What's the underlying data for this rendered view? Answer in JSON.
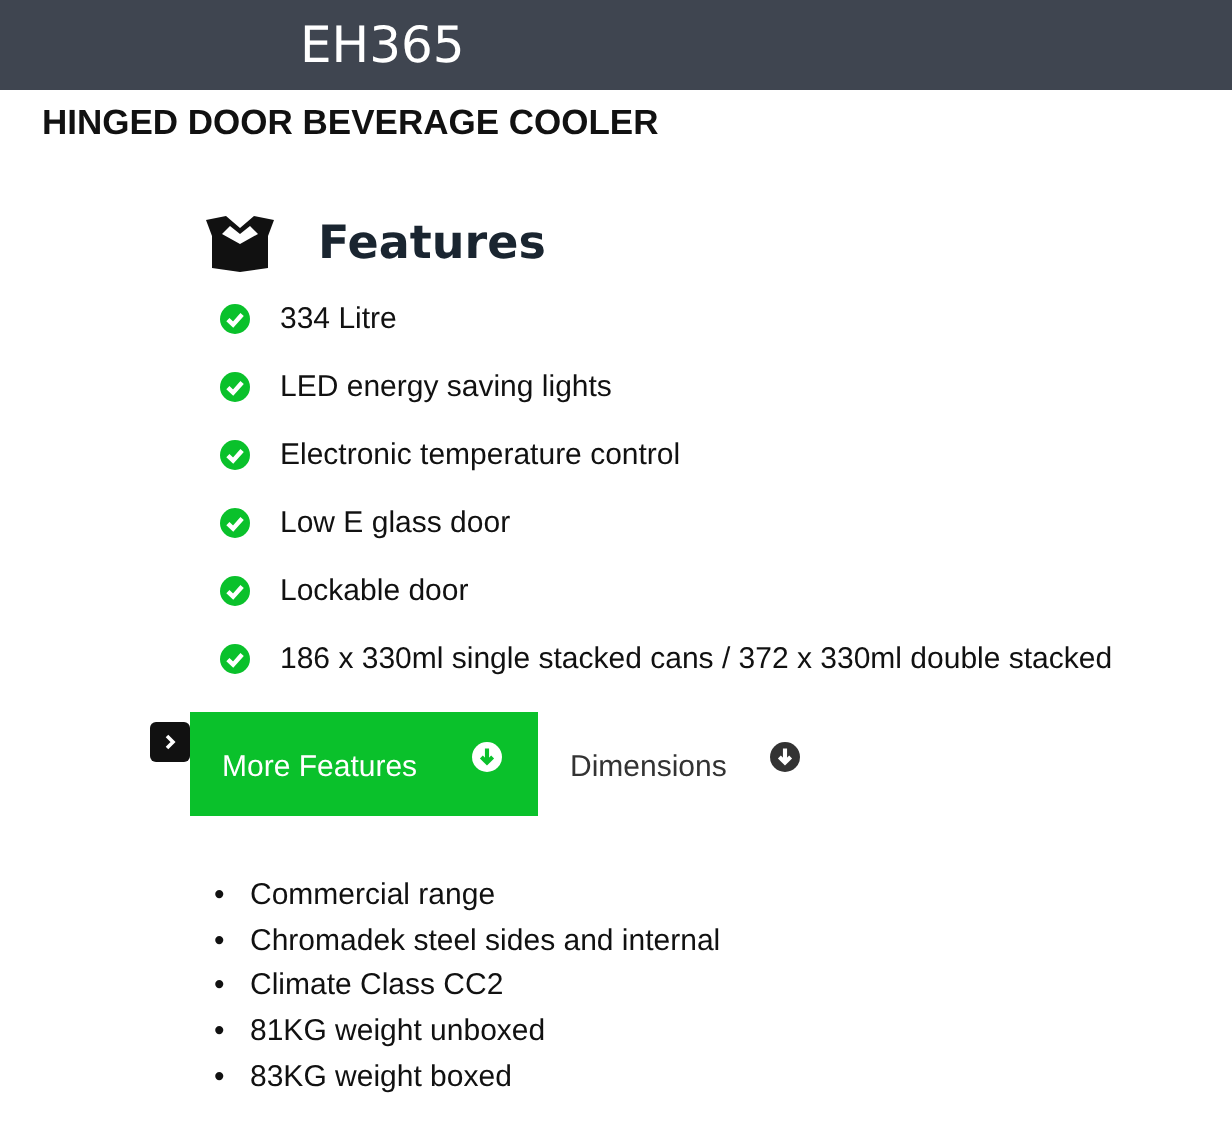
{
  "header": {
    "title": "EH365"
  },
  "subtitle": "HINGED DOOR BEVERAGE COOLER",
  "features": {
    "heading": "Features",
    "items": [
      "334 Litre",
      "LED energy saving lights",
      "Electronic temperature control",
      "Low E glass door",
      "Lockable door",
      "186 x 330ml single stacked cans / 372 x 330ml double stacked"
    ]
  },
  "tabs": [
    {
      "label": "More Features",
      "selected": true
    },
    {
      "label": "Dimensions",
      "selected": false
    }
  ],
  "more_features": [
    {
      "marker": "•",
      "text": "Commercial range"
    },
    {
      "marker": "•",
      "text": "Chromadek steel sides and internal"
    },
    {
      "marker": "•",
      "text": "Climate Class CC2"
    },
    {
      "marker": "•",
      "text": "81KG weight unboxed"
    },
    {
      "marker": "•",
      "text": "83KG weight boxed"
    }
  ]
}
